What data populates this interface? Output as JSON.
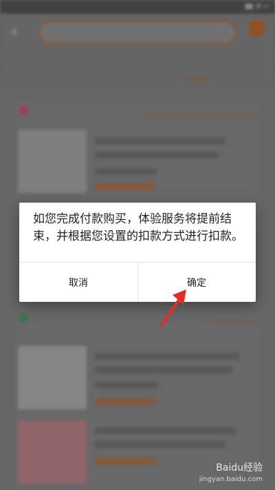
{
  "dialog": {
    "message": "如您完成付款购买，体验服务将提前结束，并根据您设置的扣款方式进行扣款。",
    "cancel_label": "取消",
    "confirm_label": "确定"
  },
  "watermark": {
    "brand": "Baidu经验",
    "url": "jingyan.baidu.com"
  },
  "colors": {
    "accent": "#b4622b",
    "dialog_bg": "#ffffff",
    "arrow": "#e52d27"
  }
}
